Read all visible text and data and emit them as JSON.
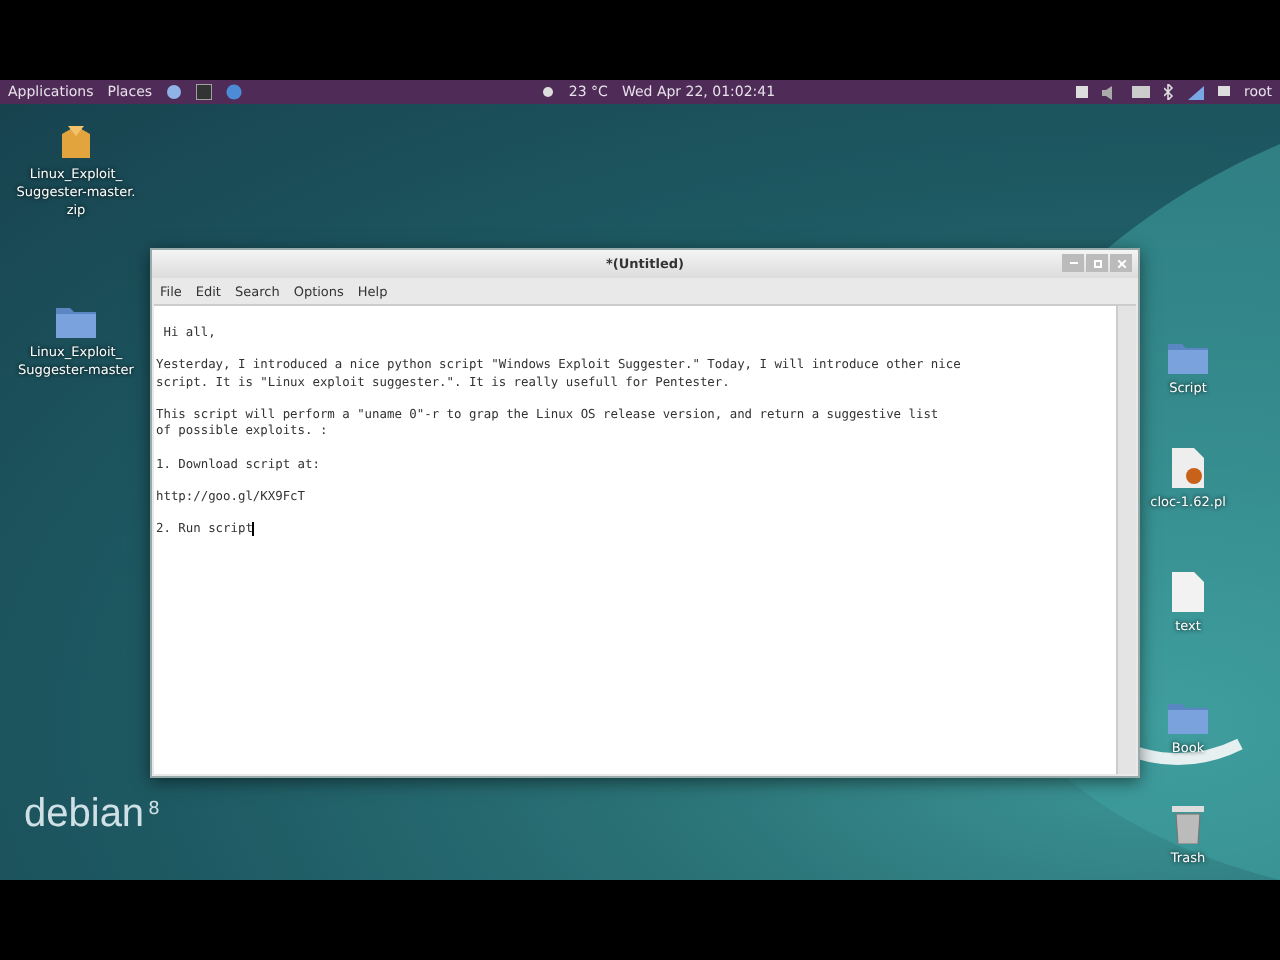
{
  "panel": {
    "menus": [
      "Applications",
      "Places"
    ],
    "weather": "23 °C",
    "clock": "Wed Apr 22, 01:02:41",
    "user": "root"
  },
  "desktop_icons_left": [
    {
      "kind": "archive",
      "label": "Linux_Exploit_ Suggester-master. zip"
    },
    {
      "kind": "folder",
      "label": "Linux_Exploit_ Suggester-master"
    }
  ],
  "desktop_icons_right": [
    {
      "kind": "folder",
      "label": "Script"
    },
    {
      "kind": "script",
      "label": "cloc-1.62.pl"
    },
    {
      "kind": "document",
      "label": "text"
    },
    {
      "kind": "folder",
      "label": "Book"
    },
    {
      "kind": "trash",
      "label": "Trash"
    }
  ],
  "window": {
    "title": "*(Untitled)",
    "menu": [
      "File",
      "Edit",
      "Search",
      "Options",
      "Help"
    ],
    "paragraphs": [
      [
        " Hi all,"
      ],
      [
        "Yesterday, I introduced a nice python script \"Windows Exploit Suggester.\" Today, I will introduce other nice",
        "script. It is \"Linux exploit suggester.\". It is really usefull for Pentester."
      ],
      [
        "This script will perform a \"uname 0\"-r to grap the Linux OS release version, and return a suggestive list",
        "of possible exploits. :"
      ],
      [
        "1. Download script at:"
      ],
      [
        "http://goo.gl/KX9FcT"
      ],
      [
        "2. Run script"
      ]
    ]
  },
  "logo": {
    "name": "debian",
    "version": "8"
  }
}
